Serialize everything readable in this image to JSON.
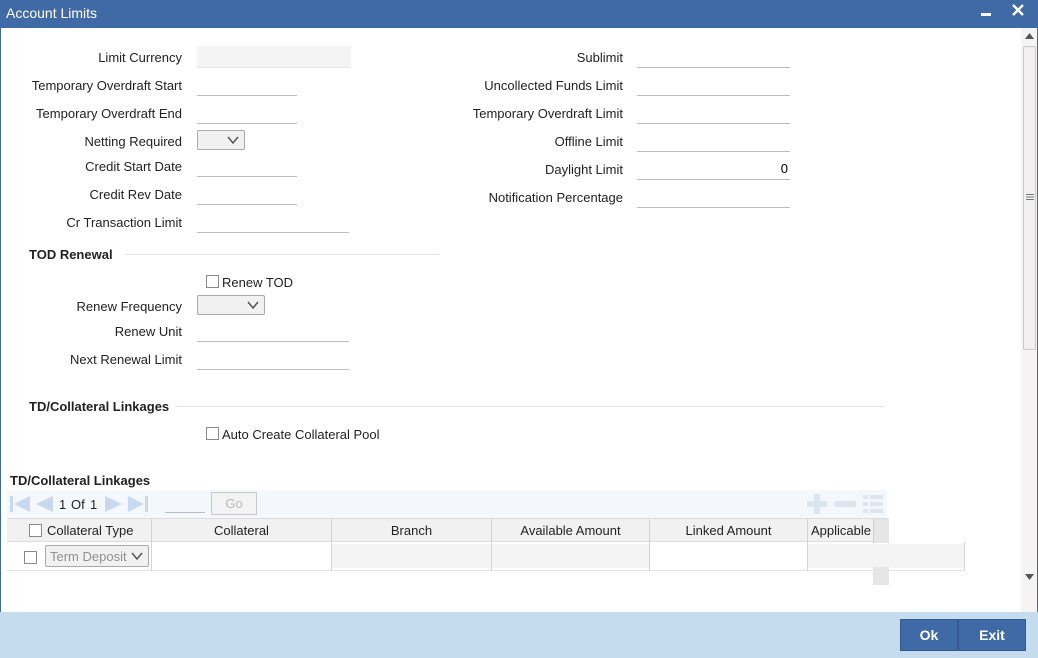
{
  "window": {
    "title": "Account Limits",
    "minimize_icon": "minimize-icon",
    "close_icon": "close-icon"
  },
  "left_fields": [
    {
      "label": "Limit Currency",
      "value": ""
    },
    {
      "label": "Temporary Overdraft Start",
      "value": ""
    },
    {
      "label": "Temporary Overdraft End",
      "value": ""
    },
    {
      "label": "Netting Required",
      "value": ""
    },
    {
      "label": "Credit Start Date",
      "value": ""
    },
    {
      "label": "Credit Rev Date",
      "value": ""
    },
    {
      "label": "Cr Transaction Limit",
      "value": ""
    }
  ],
  "right_fields": [
    {
      "label": "Sublimit",
      "value": ""
    },
    {
      "label": "Uncollected Funds Limit",
      "value": ""
    },
    {
      "label": "Temporary Overdraft Limit",
      "value": ""
    },
    {
      "label": "Offline Limit",
      "value": ""
    },
    {
      "label": "Daylight Limit",
      "value": "0"
    },
    {
      "label": "Notification Percentage",
      "value": ""
    }
  ],
  "tod_renewal": {
    "title": "TOD Renewal",
    "renew_tod_label": "Renew TOD",
    "renew_tod_checked": false,
    "renew_frequency_label": "Renew Frequency",
    "renew_unit_label": "Renew Unit",
    "next_renewal_limit_label": "Next Renewal Limit"
  },
  "collateral_section": {
    "title": "TD/Collateral Linkages",
    "auto_create_label": "Auto Create Collateral Pool",
    "auto_create_checked": false
  },
  "grid": {
    "title": "TD/Collateral Linkages",
    "page_current": "1",
    "page_of": "Of",
    "page_total": "1",
    "go_label": "Go",
    "columns": [
      "Collateral Type",
      "Collateral",
      "Branch",
      "Available Amount",
      "Linked Amount",
      "Applicable"
    ],
    "rows": [
      {
        "collateral_type": "Term Deposit",
        "collateral": "",
        "branch": "",
        "available_amount": "",
        "linked_amount": "",
        "applicable": ""
      }
    ]
  },
  "footer": {
    "ok_label": "Ok",
    "exit_label": "Exit"
  },
  "colors": {
    "titlebar": "#3f6aa5",
    "footer": "#c5dcee",
    "button": "#3f6aa5"
  }
}
